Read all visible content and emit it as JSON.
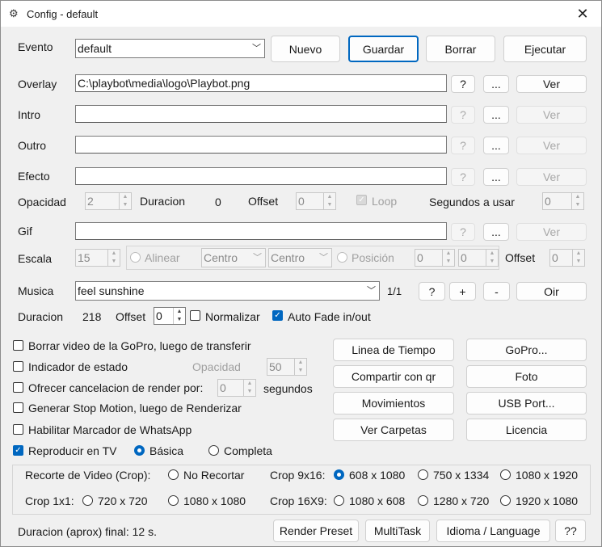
{
  "window": {
    "title": "Config - default",
    "close_glyph": "✕"
  },
  "evento": {
    "label": "Evento",
    "value": "default"
  },
  "top_buttons": {
    "nuevo": "Nuevo",
    "guardar": "Guardar",
    "borrar": "Borrar",
    "ejecutar": "Ejecutar"
  },
  "overlay": {
    "label": "Overlay",
    "value": "C:\\playbot\\media\\logo\\Playbot.png"
  },
  "intro": {
    "label": "Intro",
    "value": ""
  },
  "outro": {
    "label": "Outro",
    "value": ""
  },
  "efecto": {
    "label": "Efecto",
    "value": ""
  },
  "gif": {
    "label": "Gif",
    "value": ""
  },
  "row_buttons": {
    "help": "?",
    "browse": "...",
    "ver": "Ver"
  },
  "opacidad_row": {
    "opacidad_label": "Opacidad",
    "opacidad_value": "2",
    "duracion_label": "Duracion",
    "duracion_value": "0",
    "offset_label": "Offset",
    "offset_value": "0",
    "loop_label": "Loop",
    "segundos_label": "Segundos a usar",
    "segundos_value": "0"
  },
  "escala_row": {
    "escala_label": "Escala",
    "escala_value": "15",
    "alinear_label": "Alinear",
    "horiz_value": "Centro",
    "vert_value": "Centro",
    "posicion_label": "Posición",
    "pos_x": "0",
    "pos_y": "0",
    "offset_label": "Offset",
    "offset_value": "0"
  },
  "musica": {
    "label": "Musica",
    "value": "feel sunshine",
    "counter": "1/1",
    "help": "?",
    "add": "+",
    "remove": "-",
    "play": "Oir"
  },
  "duracion_row": {
    "label": "Duracion",
    "value": "218",
    "offset_label": "Offset",
    "offset_value": "0",
    "normalizar": "Normalizar",
    "autofade": "Auto Fade in/out"
  },
  "options": {
    "borrar_gopro": "Borrar video de la GoPro, luego de transferir",
    "indicador": "Indicador de estado",
    "opacidad_label": "Opacidad",
    "opacidad_value": "50",
    "ofrecer": "Ofrecer cancelacion de render por:",
    "ofrecer_value": "0",
    "segundos": "segundos",
    "stop_motion": "Generar Stop Motion, luego de Renderizar",
    "whatsapp": "Habilitar Marcador de WhatsApp",
    "reproducir_tv": "Reproducir en TV",
    "basica": "Básica",
    "completa": "Completa"
  },
  "side_buttons": {
    "linea": "Linea de Tiempo",
    "gopro": "GoPro...",
    "compartir": "Compartir con qr",
    "foto": "Foto",
    "movimientos": "Movimientos",
    "usb": "USB Port...",
    "carpetas": "Ver Carpetas",
    "licencia": "Licencia"
  },
  "crop": {
    "title": "Recorte de Video (Crop):",
    "no_recortar": "No Recortar",
    "c916_label": "Crop 9x16:",
    "c916_a": "608 x 1080",
    "c916_b": "750 x 1334",
    "c916_c": "1080 x 1920",
    "c11_label": "Crop 1x1:",
    "c11_a": "720 x 720",
    "c11_b": "1080 x 1080",
    "c169_label": "Crop 16X9:",
    "c169_a": "1080 x 608",
    "c169_b": "1280 x 720",
    "c169_c": "1920 x 1080"
  },
  "footer": {
    "duracion_final": "Duracion (aprox) final: 12 s.",
    "render": "Render Preset",
    "multitask": "MultiTask",
    "idioma": "Idioma / Language",
    "help": "??"
  },
  "colors": {
    "accent": "#0067c0",
    "window_bg": "#f0f0f0"
  },
  "icons": {
    "app": "app-config-icon",
    "close": "close-icon",
    "dropdown": "chevron-down-icon",
    "spinner": "spin-arrows-icon"
  }
}
